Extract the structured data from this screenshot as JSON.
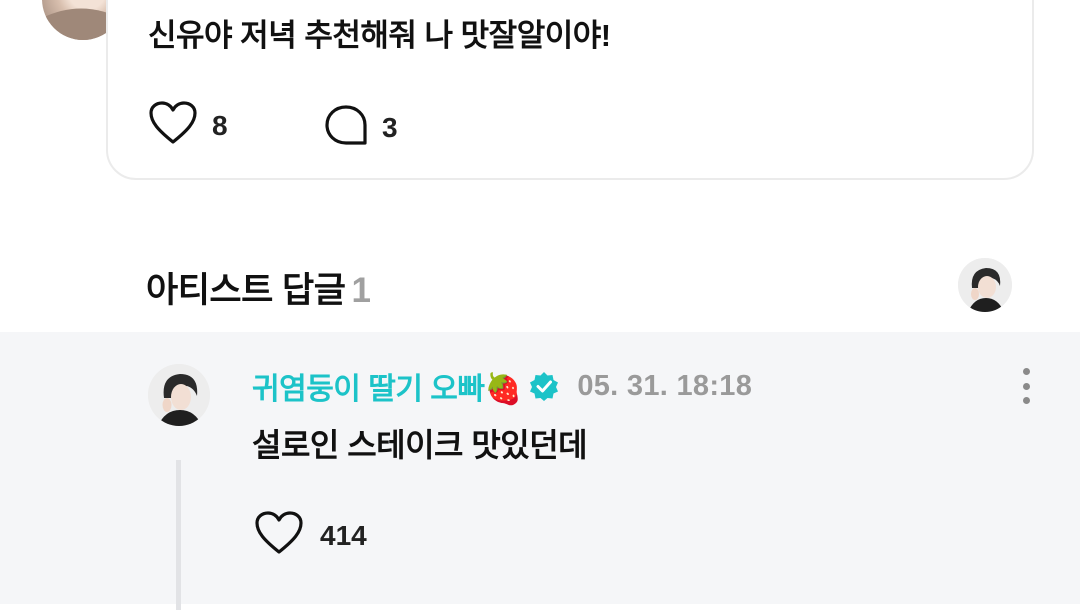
{
  "post": {
    "text": "신유야 저녁 추천해줘 나 맛잘알이야!",
    "like_count": "8",
    "comment_count": "3"
  },
  "artist_replies": {
    "title": "아티스트 답글",
    "count": "1"
  },
  "reply": {
    "author": "귀염둥이 딸기 오빠🍓",
    "timestamp": "05. 31. 18:18",
    "text": "설로인 스테이크 맛있던데",
    "like_count": "414",
    "accent_color": "#1cc3c8"
  }
}
